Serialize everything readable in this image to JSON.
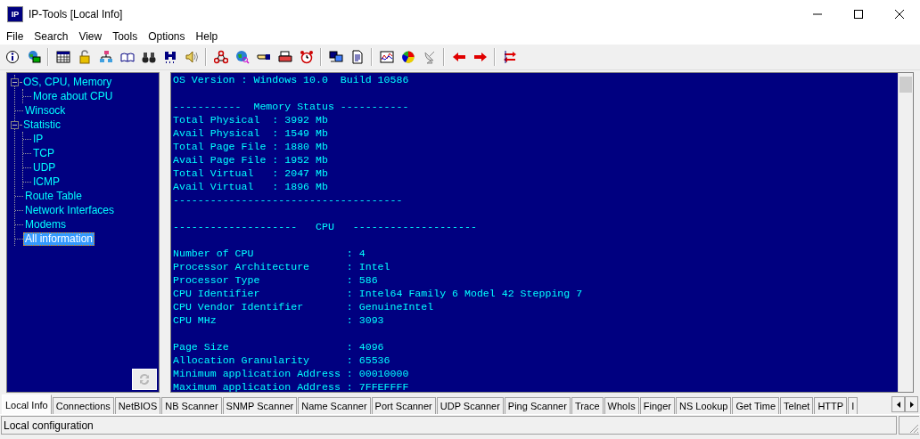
{
  "window": {
    "icon_text": "IP",
    "title": "IP-Tools [Local Info]"
  },
  "menu": [
    "File",
    "Search",
    "View",
    "Tools",
    "Options",
    "Help"
  ],
  "tree": [
    {
      "label": "OS, CPU, Memory",
      "expanded": true,
      "selected": false,
      "children": [
        {
          "label": "More about CPU",
          "selected": false
        }
      ]
    },
    {
      "label": "Winsock",
      "selected": false
    },
    {
      "label": "Statistic",
      "expanded": true,
      "selected": false,
      "children": [
        {
          "label": "IP",
          "selected": false
        },
        {
          "label": "TCP",
          "selected": false
        },
        {
          "label": "UDP",
          "selected": false
        },
        {
          "label": "ICMP",
          "selected": false
        }
      ]
    },
    {
      "label": "Route Table",
      "selected": false
    },
    {
      "label": "Network Interfaces",
      "selected": false
    },
    {
      "label": "Modems",
      "selected": false
    },
    {
      "label": "All information",
      "selected": true
    }
  ],
  "refresh_button": {
    "disabled": true
  },
  "console": {
    "blocks": [
      [
        "OS Version : Windows 10.0  Build 10586"
      ],
      [
        "-----------  Memory Status -----------",
        "Total Physical  : 3992 Mb",
        "Avail Physical  : 1549 Mb",
        "Total Page File : 1880 Mb",
        "Avail Page File : 1952 Mb",
        "Total Virtual   : 2047 Mb",
        "Avail Virtual   : 1896 Mb",
        "-------------------------------------"
      ],
      [
        "--------------------   CPU   --------------------"
      ],
      [
        "Number of CPU               : 4",
        "Processor Architecture      : Intel",
        "Processor Type              : 586",
        "CPU Identifier              : Intel64 Family 6 Model 42 Stepping 7",
        "CPU Vendor Identifier       : GenuineIntel",
        "CPU MHz                     : 3093"
      ],
      [
        "Page Size                   : 4096",
        "Allocation Granularity      : 65536",
        "Minimum application Address : 00010000",
        "Maximum application Address : 7FFEFFFF"
      ]
    ]
  },
  "tabs": [
    {
      "label": "Local Info",
      "selected": true
    },
    {
      "label": "Connections",
      "selected": false
    },
    {
      "label": "NetBIOS",
      "selected": false
    },
    {
      "label": "NB Scanner",
      "selected": false
    },
    {
      "label": "SNMP Scanner",
      "selected": false
    },
    {
      "label": "Name Scanner",
      "selected": false
    },
    {
      "label": "Port Scanner",
      "selected": false
    },
    {
      "label": "UDP Scanner",
      "selected": false
    },
    {
      "label": "Ping Scanner",
      "selected": false
    },
    {
      "label": "Trace",
      "selected": false
    },
    {
      "label": "WhoIs",
      "selected": false
    },
    {
      "label": "Finger",
      "selected": false
    },
    {
      "label": "NS Lookup",
      "selected": false
    },
    {
      "label": "Get Time",
      "selected": false
    },
    {
      "label": "Telnet",
      "selected": false
    },
    {
      "label": "HTTP",
      "selected": false
    },
    {
      "label": "I",
      "selected": false
    }
  ],
  "status_bar": "Local configuration"
}
